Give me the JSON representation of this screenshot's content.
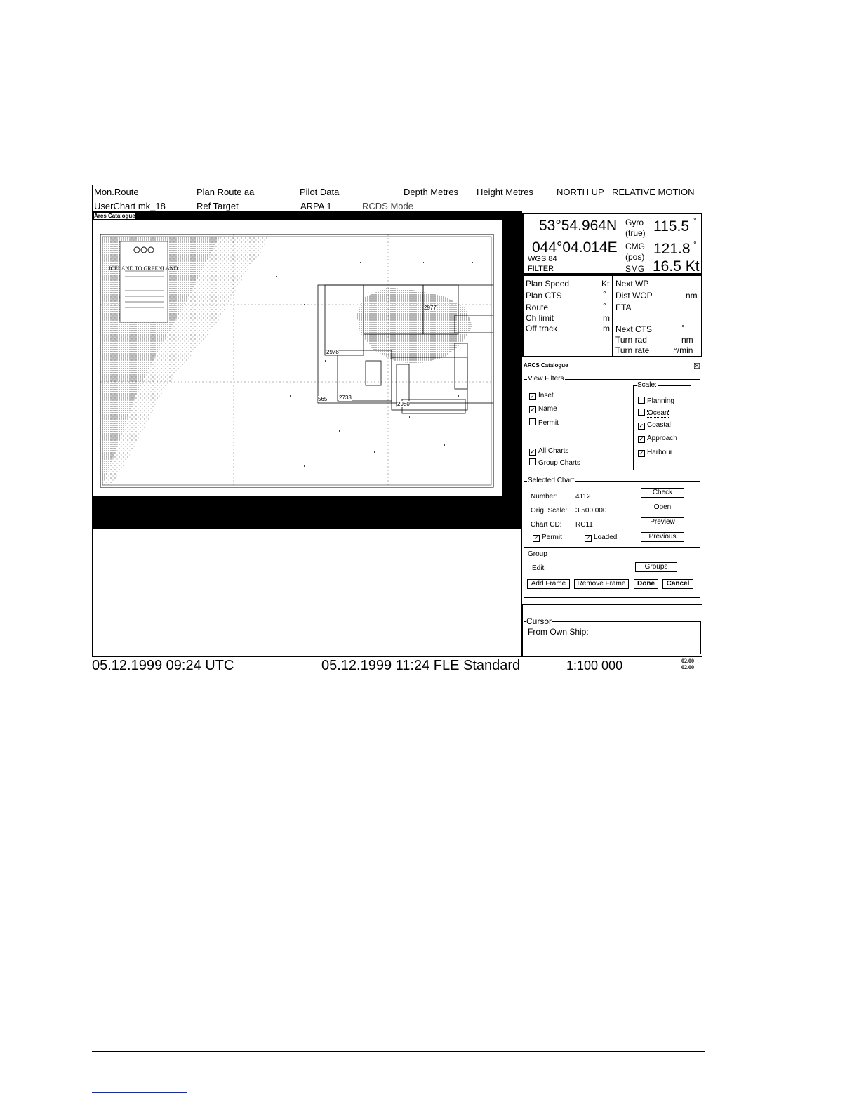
{
  "topbar": {
    "mon_route": "Mon.Route",
    "plan_route": "Plan Route aa",
    "pilot_data": "Pilot Data",
    "depth": "Depth Metres",
    "height": "Height Metres",
    "orientation": "NORTH UP",
    "motion": "RELATIVE MOTION",
    "userchart": "UserChart  mk_18",
    "ref_target": "Ref Target",
    "arpa": "ARPA 1",
    "rcds": "RCDS Mode"
  },
  "chart_window": {
    "title": "Arcs Catalogue",
    "map_title": "ICELAND TO GREENLAND",
    "frames": [
      "565",
      "2733",
      "2978",
      "2980",
      "2977"
    ]
  },
  "position": {
    "lat": "53°54.964N",
    "lon": "044°04.014E",
    "datum": "WGS 84",
    "filter": "FILTER",
    "gyro_label": "Gyro",
    "gyro_sub": "(true)",
    "gyro_val": "115.5",
    "deg": "°",
    "cmg_label": "CMG",
    "cmg_sub": "(pos)",
    "cmg_val": "121.8",
    "smg_label": "SMG",
    "smg_val": "16.5 Kt"
  },
  "route_info": {
    "plan_speed": "Plan Speed",
    "plan_speed_unit": "Kt",
    "plan_cts": "Plan CTS",
    "plan_cts_unit": "°",
    "route": "Route",
    "route_unit": "°",
    "ch_limit": "Ch limit",
    "ch_limit_unit": "m",
    "off_track": "Off track",
    "off_track_unit": "m",
    "next_wp": "Next WP",
    "dist_wop": "Dist WOP",
    "dist_wop_unit": "nm",
    "eta": "ETA",
    "next_cts": "Next CTS",
    "next_cts_unit": "°",
    "turn_rad": "Turn rad",
    "turn_rad_unit": "nm",
    "turn_rate": "Turn rate",
    "turn_rate_unit": "°/min"
  },
  "catalogue": {
    "title": "ARCS Catalogue",
    "close": "☒",
    "view_filters": "View Filters",
    "inset": "Inset",
    "name": "Name",
    "permit": "Permit",
    "all_charts": "All Charts",
    "group_charts": "Group Charts",
    "scale": "Scale:",
    "planning": "Planning",
    "ocean": "Ocean",
    "coastal": "Coastal",
    "approach": "Approach",
    "harbour": "Harbour",
    "selected_chart": "Selected Chart",
    "number_label": "Number:",
    "number_val": "4112",
    "orig_scale_label": "Orig. Scale:",
    "orig_scale_val": "3 500 000",
    "chart_cd_label": "Chart CD:",
    "chart_cd_val": "RC11",
    "sel_permit": "Permit",
    "loaded": "Loaded",
    "check_btn": "Check",
    "open_btn": "Open",
    "preview_btn": "Preview",
    "previous_btn": "Previous",
    "group": "Group",
    "edit": "Edit",
    "groups_btn": "Groups",
    "add_frame_btn": "Add Frame",
    "remove_frame_btn": "Remove Frame",
    "done_btn": "Done",
    "cancel_btn": "Cancel",
    "check_mark": "✓"
  },
  "cursor": {
    "title": "Cursor",
    "from_own_ship": "From Own Ship:"
  },
  "status": {
    "utc_time": "05.12.1999 09:24 UTC",
    "local_time": "05.12.1999 11:24 FLE Standard",
    "scale": "1:100 000",
    "code1": "02.00",
    "code2": "02.00"
  }
}
